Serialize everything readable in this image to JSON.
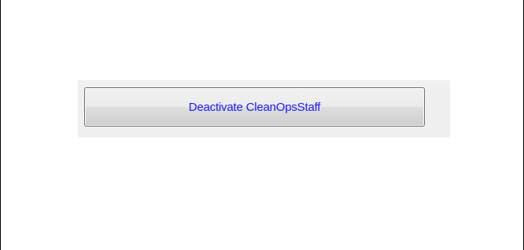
{
  "dialog": {
    "deactivate_button_label": "Deactivate CleanOpsStaff"
  },
  "colors": {
    "panel_background": "#f0f0f0",
    "button_text": "#1a1aff",
    "button_border": "#707070"
  }
}
